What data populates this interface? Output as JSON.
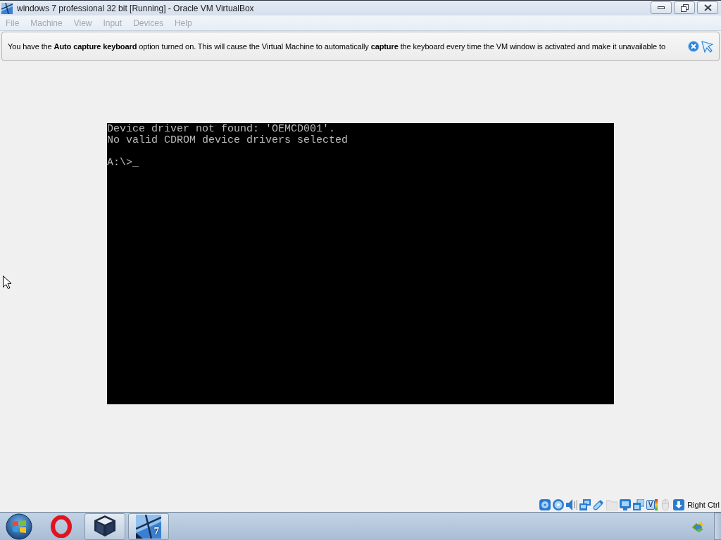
{
  "window": {
    "title": "windows 7 professional 32 bit [Running] - Oracle VM VirtualBox"
  },
  "menu": [
    {
      "label": "File",
      "disabled": true
    },
    {
      "label": "Machine",
      "disabled": true
    },
    {
      "label": "View",
      "disabled": true
    },
    {
      "label": "Input",
      "disabled": true
    },
    {
      "label": "Devices",
      "disabled": true
    },
    {
      "label": "Help",
      "disabled": true
    }
  ],
  "notice": {
    "text": "You have the **Auto capture keyboard** option turned on. This will cause the Virtual Machine to automatically **capture** the keyboard every time the VM window is activated and make it unavailable to"
  },
  "vm_screen": {
    "output": [
      "Device driver not found: 'OEMCD001'.",
      "No valid CDROM device drivers selected"
    ],
    "prompt": "A:\\>_"
  },
  "status_bar": {
    "indicators": [
      {
        "kind": "hard-disk",
        "disabled": false
      },
      {
        "kind": "optical-disc",
        "disabled": false
      },
      {
        "kind": "audio",
        "disabled": false
      },
      {
        "kind": "network",
        "disabled": false
      },
      {
        "kind": "usb",
        "disabled": false
      },
      {
        "kind": "shared-folders",
        "disabled": true
      },
      {
        "kind": "display",
        "disabled": false
      },
      {
        "kind": "video-capture",
        "disabled": false
      },
      {
        "kind": "virtualization",
        "label": "V",
        "disabled": false
      },
      {
        "kind": "mouse",
        "disabled": true
      },
      {
        "kind": "keyboard",
        "disabled": false
      }
    ],
    "host_key": "Right Ctrl"
  },
  "taskbar": {
    "buttons": [
      {
        "kind": "ring-logo",
        "open": false
      },
      {
        "kind": "cube-logo",
        "open": true
      },
      {
        "kind": "tile-logo",
        "badge": "7",
        "open": true
      }
    ]
  }
}
